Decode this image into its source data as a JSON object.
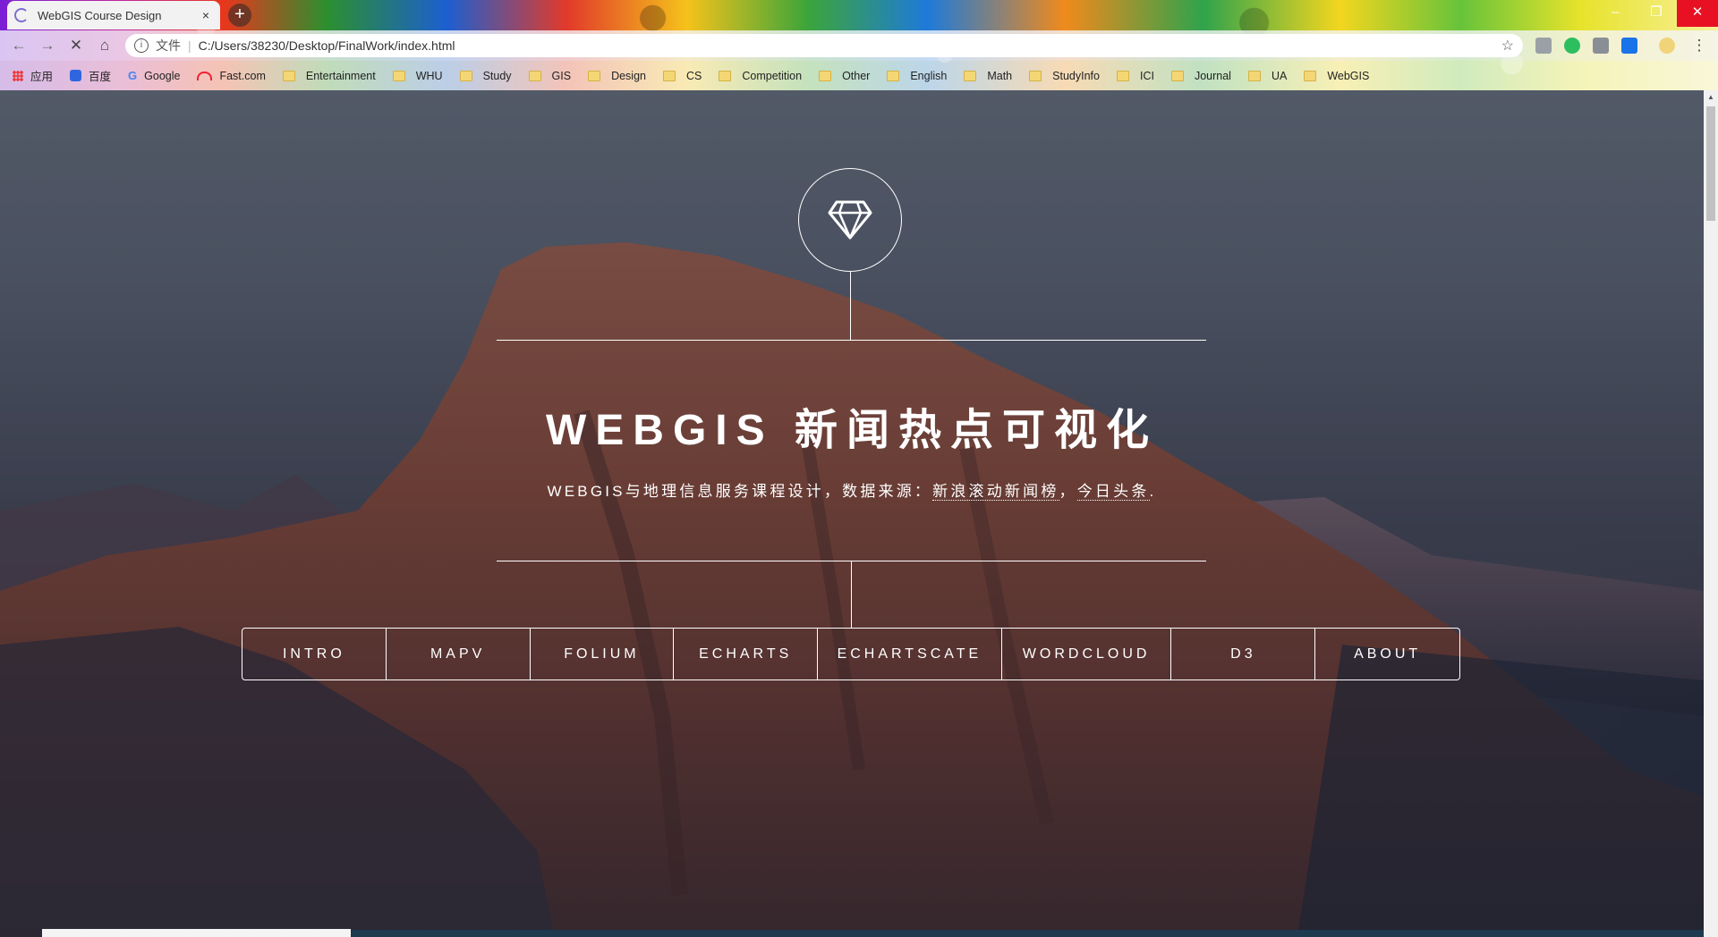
{
  "browser": {
    "tab_title": "WebGIS Course Design",
    "tab_close": "×",
    "new_tab": "+",
    "back": "←",
    "forward": "→",
    "reload": "✕",
    "home": "⌂",
    "info_glyph": "i",
    "protocol_label": "文件",
    "separator": "|",
    "url": "C:/Users/38230/Desktop/FinalWork/index.html",
    "bookmark_star": "☆",
    "window_controls": {
      "minimize": "–",
      "restore": "❐",
      "close": "✕"
    },
    "bookmarks": [
      {
        "label": "应用",
        "icon": "apps-icon"
      },
      {
        "label": "百度",
        "icon": "baidu-icon"
      },
      {
        "label": "Google",
        "icon": "google-icon"
      },
      {
        "label": "Fast.com",
        "icon": "fast-icon"
      },
      {
        "label": "Entertainment",
        "icon": "folder-icon"
      },
      {
        "label": "WHU",
        "icon": "folder-icon"
      },
      {
        "label": "Study",
        "icon": "folder-icon"
      },
      {
        "label": "GIS",
        "icon": "folder-icon"
      },
      {
        "label": "Design",
        "icon": "folder-icon"
      },
      {
        "label": "CS",
        "icon": "folder-icon"
      },
      {
        "label": "Competition",
        "icon": "folder-icon"
      },
      {
        "label": "Other",
        "icon": "folder-icon"
      },
      {
        "label": "English",
        "icon": "folder-icon"
      },
      {
        "label": "Math",
        "icon": "folder-icon"
      },
      {
        "label": "StudyInfo",
        "icon": "folder-icon"
      },
      {
        "label": "ICI",
        "icon": "folder-icon"
      },
      {
        "label": "Journal",
        "icon": "folder-icon"
      },
      {
        "label": "UA",
        "icon": "folder-icon"
      },
      {
        "label": "WebGIS",
        "icon": "folder-icon"
      }
    ]
  },
  "hero": {
    "icon": "diamond-icon",
    "title": "WEBGIS 新闻热点可视化",
    "subtitle_prefix": "WEBGIS与地理信息服务课程设计，数据来源：",
    "subtitle_link1": "新浪滚动新闻榜",
    "subtitle_sep": "，",
    "subtitle_link2": "今日头条",
    "subtitle_suffix": "."
  },
  "nav": {
    "items": [
      "INTRO",
      "MAPV",
      "FOLIUM",
      "ECHARTS",
      "ECHARTSCATE",
      "WORDCLOUD",
      "D3",
      "ABOUT"
    ]
  },
  "colors": {
    "text": "#ffffff",
    "accent_close": "#e81123"
  }
}
